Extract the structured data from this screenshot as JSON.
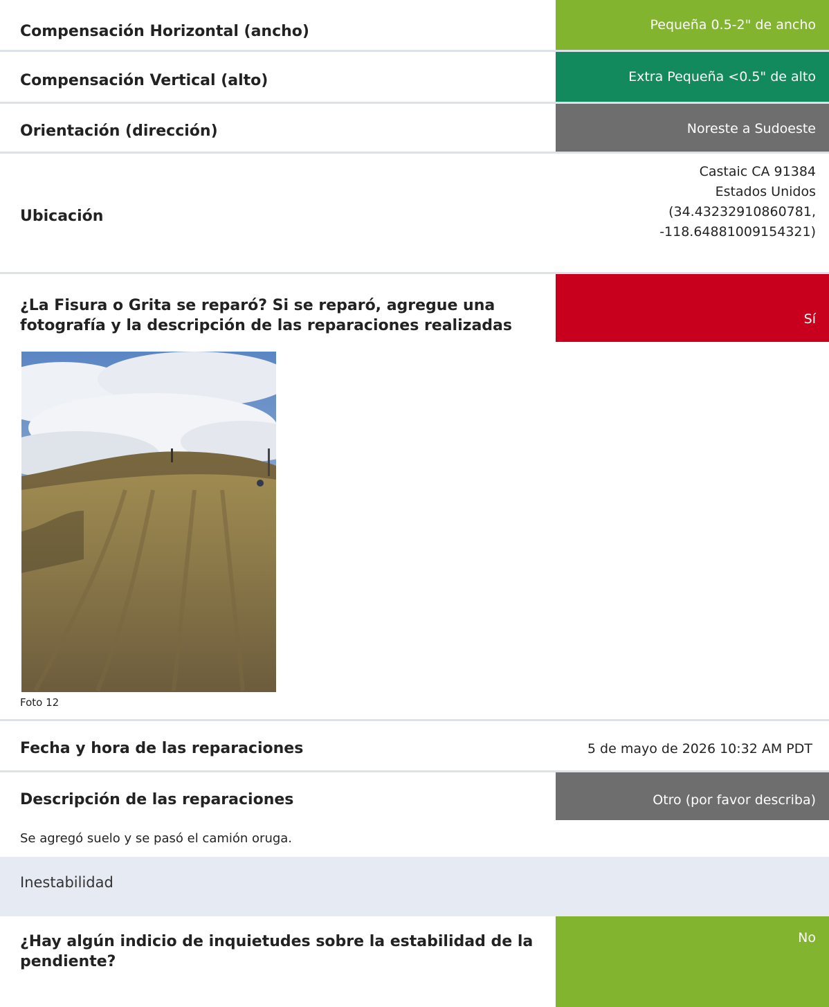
{
  "rows": {
    "horizontal": {
      "label": "Compensación Horizontal (ancho)",
      "value": "Pequeña 0.5-2\" de ancho",
      "color": "#82b430"
    },
    "vertical": {
      "label": "Compensación Vertical (alto)",
      "value": "Extra Pequeña <0.5\" de alto",
      "color": "#138a5e"
    },
    "orientation": {
      "label": "Orientación (dirección)",
      "value": "Noreste a Sudoeste",
      "color": "#6e6e6e"
    },
    "location": {
      "label": "Ubicación",
      "lines": [
        "Castaic CA 91384",
        "Estados Unidos",
        "(34.43232910860781,",
        "-118.64881009154321)"
      ]
    },
    "repaired": {
      "label_line1": "¿La Fisura o Grita se reparó? Si se reparó, agregue una",
      "label_line2": "fotografía y la descripción de las reparaciones realizadas",
      "value": "Sí",
      "color": "#c8001e"
    },
    "photo": {
      "caption": "Foto 12"
    },
    "repair_datetime": {
      "label": "Fecha y hora de las reparaciones",
      "value": "5 de mayo de 2026 10:32 AM PDT"
    },
    "repair_description": {
      "label": "Descripción de las reparaciones",
      "value": "Otro (por favor describa)",
      "color": "#6e6e6e",
      "note": "Se agregó suelo y se pasó el camión oruga."
    },
    "section": {
      "title": "Inestabilidad"
    },
    "stability": {
      "label_line1": "¿Hay algún indicio de inquietudes sobre la estabilidad de la",
      "label_line2": "pendiente?",
      "value": "No",
      "color": "#82b430"
    }
  }
}
